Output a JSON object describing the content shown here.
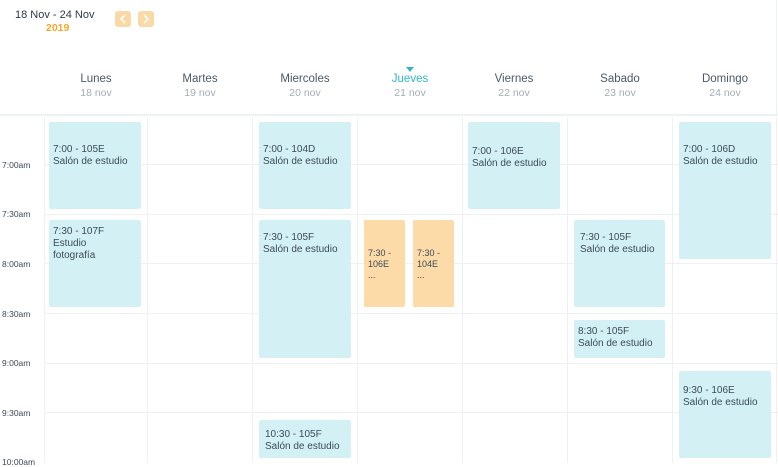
{
  "header": {
    "date_range": "18 Nov - 24 Nov",
    "year": "2019",
    "prev_icon": "chevron-left-icon",
    "next_icon": "chevron-right-icon"
  },
  "days": [
    {
      "name": "Lunes",
      "date": "18 nov"
    },
    {
      "name": "Martes",
      "date": "19 nov"
    },
    {
      "name": "Miercoles",
      "date": "20 nov"
    },
    {
      "name": "Jueves",
      "date": "21 nov",
      "today": true
    },
    {
      "name": "Viernes",
      "date": "22 nov"
    },
    {
      "name": "Sabado",
      "date": "23 nov"
    },
    {
      "name": "Domingo",
      "date": "24 nov"
    }
  ],
  "time_labels": [
    "7:00am",
    "7:30am",
    "8:00am",
    "8:30am",
    "9:00am",
    "9:30am",
    "10:00am"
  ],
  "events": {
    "mon_1": {
      "line1": "7:00 - 105E",
      "line2": "Salón de estudio"
    },
    "mon_2": {
      "line1": "7:30 - 107F",
      "line2": "Estudio",
      "line3": "fotografía"
    },
    "wed_1": {
      "line1": "7:00 - 104D",
      "line2": "Salón de estudio"
    },
    "wed_2": {
      "line1": "7:30 - 105F",
      "line2": "Salón de estudio"
    },
    "wed_3": {
      "line1": "10:30 - 105F",
      "line2": "Salón de estudio"
    },
    "thu_1": {
      "line1": "7:30 -",
      "line2": "106E",
      "line3": "..."
    },
    "thu_2": {
      "line1": "7:30 -",
      "line2": "104E",
      "line3": "..."
    },
    "fri_1": {
      "line1": "7:00 - 106E",
      "line2": "Salón de estudio"
    },
    "sat_1": {
      "line1": "7:30 - 105F",
      "line2": "Salón de estudio"
    },
    "sat_2": {
      "line1": "8:30 - 105F",
      "line2": "Salón de estudio"
    },
    "sun_1": {
      "line1": "7:00 - 106D",
      "line2": "Salón de estudio"
    },
    "sun_2": {
      "line1": "9:30 - 106E",
      "line2": "Salón de estudio"
    }
  },
  "colors": {
    "event": "#d3f1f5",
    "event_highlight": "#fcdba8",
    "accent": "#33b4c7",
    "year": "#f4a62a"
  }
}
